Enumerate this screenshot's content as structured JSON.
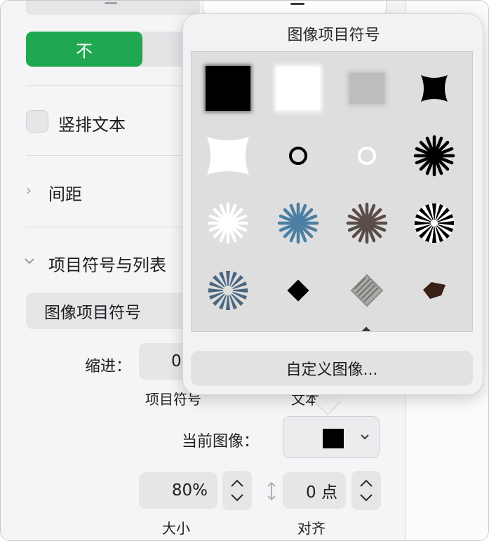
{
  "sidebar": {
    "orientation_button": "不",
    "vertical_text_label": "竖排文本",
    "spacing_label": "间距",
    "bullets_section_label": "项目符号与列表",
    "bullet_type_value": "图像项目符号",
    "indent_label": "缩进：",
    "indent_bullet_value": "0",
    "indent_bullet_caption": "项目符号",
    "indent_text_caption": "文本",
    "current_image_label": "当前图像：",
    "size_value": "80%",
    "size_caption": "大小",
    "align_value": "0 点",
    "align_caption": "对齐"
  },
  "popover": {
    "title": "图像项目符号",
    "custom_image_button": "自定义图像...",
    "bullets": [
      {
        "name": "black-square-bullet"
      },
      {
        "name": "white-square-bullet"
      },
      {
        "name": "gray-square-bullet"
      },
      {
        "name": "black-rounded-star-bullet"
      },
      {
        "name": "white-rounded-star-bullet"
      },
      {
        "name": "black-ring-bullet"
      },
      {
        "name": "white-ring-bullet"
      },
      {
        "name": "black-starburst-bullet"
      },
      {
        "name": "white-starburst-bullet"
      },
      {
        "name": "blue-starburst-bullet"
      },
      {
        "name": "brown-starburst-bullet"
      },
      {
        "name": "black-white-ray-bullet"
      },
      {
        "name": "blue-ray-bullet"
      },
      {
        "name": "black-diamond-bullet"
      },
      {
        "name": "gray-scribble-diamond-bullet"
      },
      {
        "name": "brown-diamond-bullet"
      }
    ]
  },
  "colors": {
    "accent_green": "#1fa84f",
    "panel_bg": "#f5f5f7",
    "popover_bg": "#f2f2f4"
  }
}
